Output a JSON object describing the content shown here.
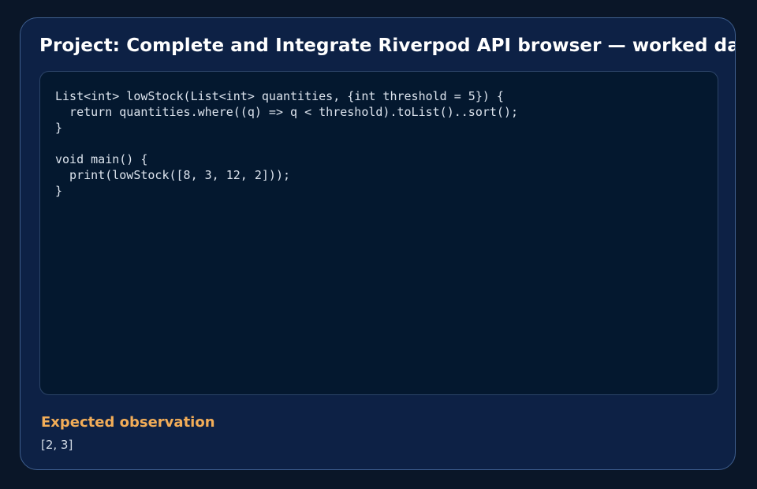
{
  "title": "Project: Complete and Integrate Riverpod API browser — worked da",
  "code": {
    "lines": [
      "List<int> lowStock(List<int> quantities, {int threshold = 5}) {",
      "  return quantities.where((q) => q < threshold).toList()..sort();",
      "}",
      "",
      "void main() {",
      "  print(lowStock([8, 3, 12, 2]));",
      "}"
    ]
  },
  "observation": {
    "label": "Expected observation",
    "value": "[2, 3]"
  },
  "colors": {
    "page_background": "#0a1628",
    "card_background": "#0d2145",
    "card_border": "#3e5e8e",
    "code_background": "#04182f",
    "title_text": "#ffffff",
    "observation_label": "#f2ad58",
    "code_text": "#dde4ee"
  }
}
